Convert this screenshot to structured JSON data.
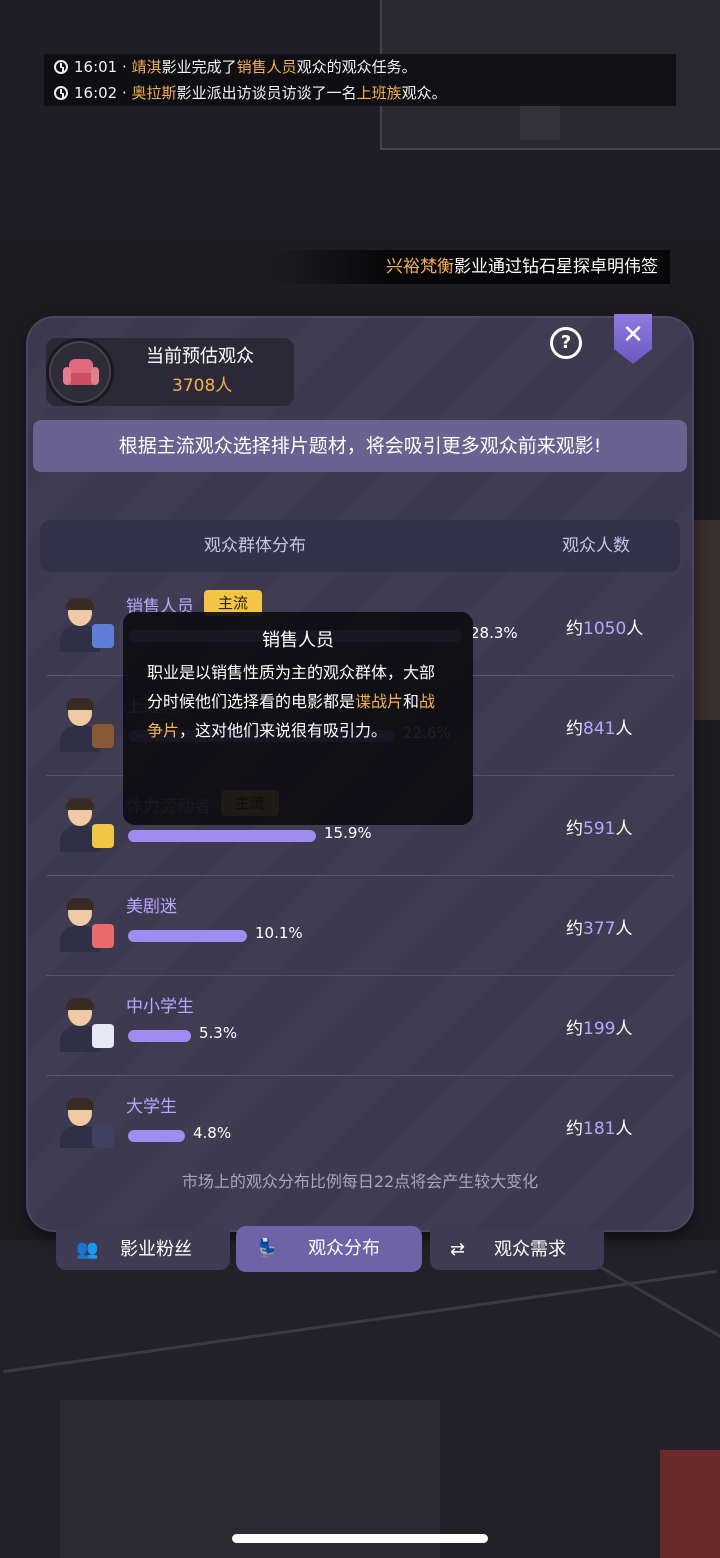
{
  "feed": [
    {
      "time": "16:01 · ",
      "studio": "靖淇",
      "mid": "影业完成了",
      "target": "销售人员",
      "tail": "观众的观众任务。"
    },
    {
      "time": "16:02 · ",
      "studio": "奥拉斯",
      "mid": "影业派出访谈员访谈了一名",
      "target": "上班族",
      "tail": "观众。"
    }
  ],
  "marquee": {
    "studio": "兴裕梵衡",
    "text": "影业通过钻石星探卓明伟签"
  },
  "panel": {
    "estimate_title": "当前预估观众",
    "estimate_value": "3708人",
    "help_label": "?",
    "close_label": "✕",
    "banner": "根据主流观众选择排片题材，将会吸引更多观众前来观影!",
    "col_left": "观众群体分布",
    "col_right": "观众人数",
    "footer": "市场上的观众分布比例每日22点将会产生较大变化"
  },
  "groups": [
    {
      "name": "销售人员",
      "badge": "主流",
      "percent_label": "28.3%",
      "percent": 28.3,
      "approx": "约",
      "count": "1050",
      "unit": "人",
      "prop_color": "#5f7fd6"
    },
    {
      "name": "上班族",
      "badge": "",
      "percent_label": "22.6%",
      "percent": 22.6,
      "approx": "约",
      "count": "841",
      "unit": "人",
      "prop_color": "#8a5a35"
    },
    {
      "name": "体力劳动者",
      "badge": "主流",
      "percent_label": "15.9%",
      "percent": 15.9,
      "approx": "约",
      "count": "591",
      "unit": "人",
      "prop_color": "#f2c544"
    },
    {
      "name": "美剧迷",
      "badge": "",
      "percent_label": "10.1%",
      "percent": 10.1,
      "approx": "约",
      "count": "377",
      "unit": "人",
      "prop_color": "#e86a6a"
    },
    {
      "name": "中小学生",
      "badge": "",
      "percent_label": "5.3%",
      "percent": 5.3,
      "approx": "约",
      "count": "199",
      "unit": "人",
      "prop_color": "#e8e8f2"
    },
    {
      "name": "大学生",
      "badge": "",
      "percent_label": "4.8%",
      "percent": 4.8,
      "approx": "约",
      "count": "181",
      "unit": "人",
      "prop_color": "#404060"
    }
  ],
  "tooltip": {
    "title": "销售人员",
    "body_1": "职业是以销售性质为主的观众群体，大部分时候他们选择看的电影都是",
    "genre_1": "谍战片",
    "and": "和",
    "genre_2": "战争片",
    "body_2": "，这对他们来说很有吸引力。"
  },
  "tabs": [
    {
      "label": "影业粉丝",
      "icon": "fans-icon",
      "glyph": "👥"
    },
    {
      "label": "观众分布",
      "icon": "seat-icon",
      "glyph": "💺"
    },
    {
      "label": "观众需求",
      "icon": "swap-icon",
      "glyph": "⇄"
    }
  ]
}
